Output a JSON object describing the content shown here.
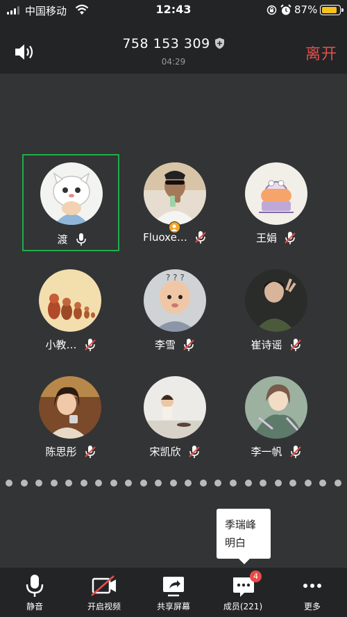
{
  "status_bar": {
    "carrier": "中国移动",
    "time": "12:43",
    "battery_percent": "87%",
    "battery_level": 0.87,
    "icons": [
      "signal-icon",
      "wifi-icon",
      "rotation-lock-icon",
      "alarm-icon",
      "battery-icon"
    ]
  },
  "header": {
    "meeting_id": "758 153 309",
    "duration": "04:29",
    "leave_label": "离开",
    "icons": [
      "speaker-icon",
      "shield-icon"
    ]
  },
  "participants": [
    {
      "name": "渡",
      "mic": "on",
      "active_speaker": true
    },
    {
      "name": "Fluoxe…",
      "mic": "muted",
      "host": true
    },
    {
      "name": "王娟",
      "mic": "muted"
    },
    {
      "name": "小教…",
      "mic": "muted"
    },
    {
      "name": "李雪",
      "mic": "muted"
    },
    {
      "name": "崔诗谣",
      "mic": "muted"
    },
    {
      "name": "陈思彤",
      "mic": "muted"
    },
    {
      "name": "宋凯欣",
      "mic": "muted"
    },
    {
      "name": "李一帆",
      "mic": "muted"
    }
  ],
  "pagination": {
    "dot_count": 23
  },
  "tooltip": {
    "line1": "季瑞峰",
    "line2": "明白"
  },
  "toolbar": {
    "mute_label": "静音",
    "video_label": "开启视频",
    "share_label": "共享屏幕",
    "members_label": "成员(221)",
    "members_badge": "4",
    "more_label": "更多"
  },
  "colors": {
    "background": "#333436",
    "bar": "#232426",
    "leave": "#e34f4a",
    "active_border": "#1fae4a",
    "badge": "#e94b45"
  }
}
